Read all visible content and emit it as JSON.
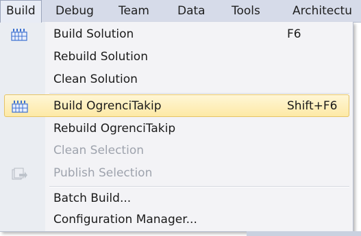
{
  "menubar": {
    "items": [
      {
        "label": "Build"
      },
      {
        "label": "Debug"
      },
      {
        "label": "Team"
      },
      {
        "label": "Data"
      },
      {
        "label": "Tools"
      },
      {
        "label": "Architectu"
      }
    ]
  },
  "menu": {
    "items": [
      {
        "label": "Build Solution",
        "shortcut": "F6",
        "icon": "build-grid-icon"
      },
      {
        "label": "Rebuild Solution"
      },
      {
        "label": "Clean Solution"
      },
      {
        "label": "Build OgrenciTakip",
        "shortcut": "Shift+F6",
        "icon": "build-grid-icon"
      },
      {
        "label": "Rebuild OgrenciTakip"
      },
      {
        "label": "Clean Selection"
      },
      {
        "label": "Publish Selection",
        "icon": "publish-icon"
      },
      {
        "label": "Batch Build..."
      },
      {
        "label": "Configuration Manager..."
      }
    ]
  },
  "colors": {
    "menubar_bg": "#d6dbe9",
    "highlight_bg": "#fde9a6",
    "highlight_border": "#e5c365",
    "disabled_text": "#9ea3ad",
    "icon_blue": "#3a6fd0"
  }
}
